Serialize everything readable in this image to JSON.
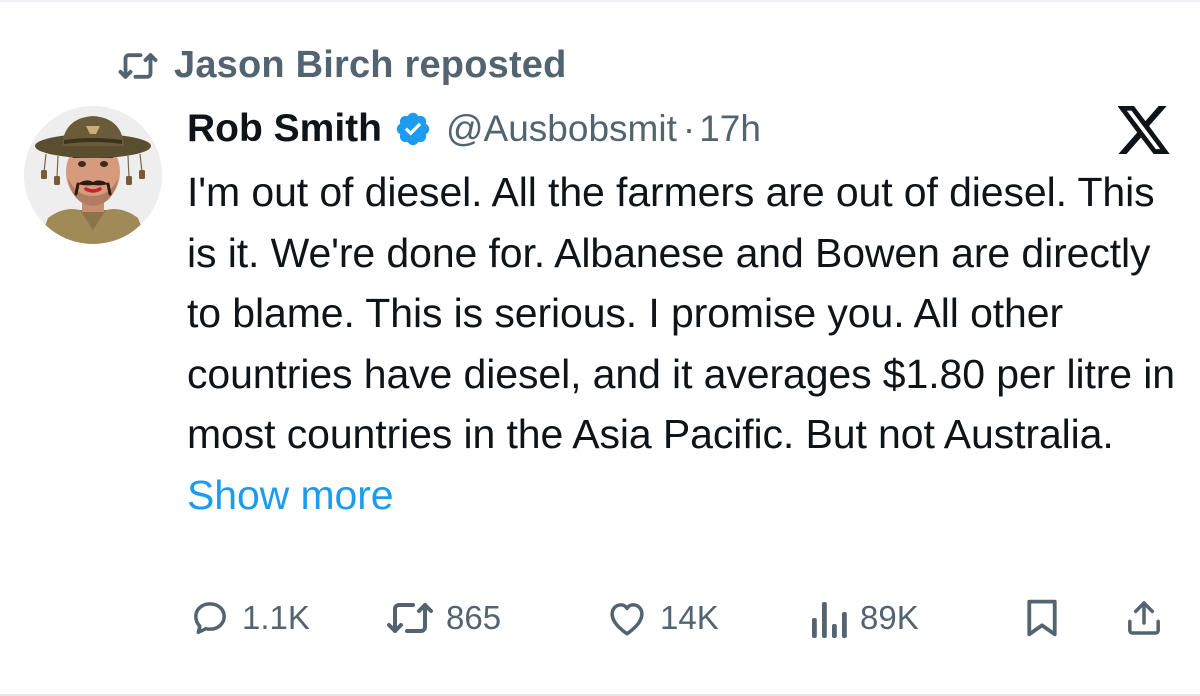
{
  "repost": {
    "text": "Jason Birch reposted",
    "icon": "repost-icon"
  },
  "author": {
    "name": "Rob Smith",
    "handle": "@Ausbobsmit",
    "separator": "·",
    "time": "17h",
    "verified": true,
    "verified_color": "#1d9bf0"
  },
  "platform_logo": "x-logo-icon",
  "tweet": {
    "text": "I'm out of diesel. All the farmers are out of diesel. This is it. We're done for. Albanese and Bowen are directly to blame. This is serious. I promise you. All other countries have diesel, and it averages $1.80 per litre in most countries in the Asia Pacific. But not Australia.",
    "show_more": "Show more",
    "link_color": "#1d9bf0"
  },
  "actions": {
    "replies": "1.1K",
    "reposts": "865",
    "likes": "14K",
    "views": "89K"
  },
  "colors": {
    "text": "#0f1419",
    "secondary": "#536471",
    "accent": "#1d9bf0"
  }
}
